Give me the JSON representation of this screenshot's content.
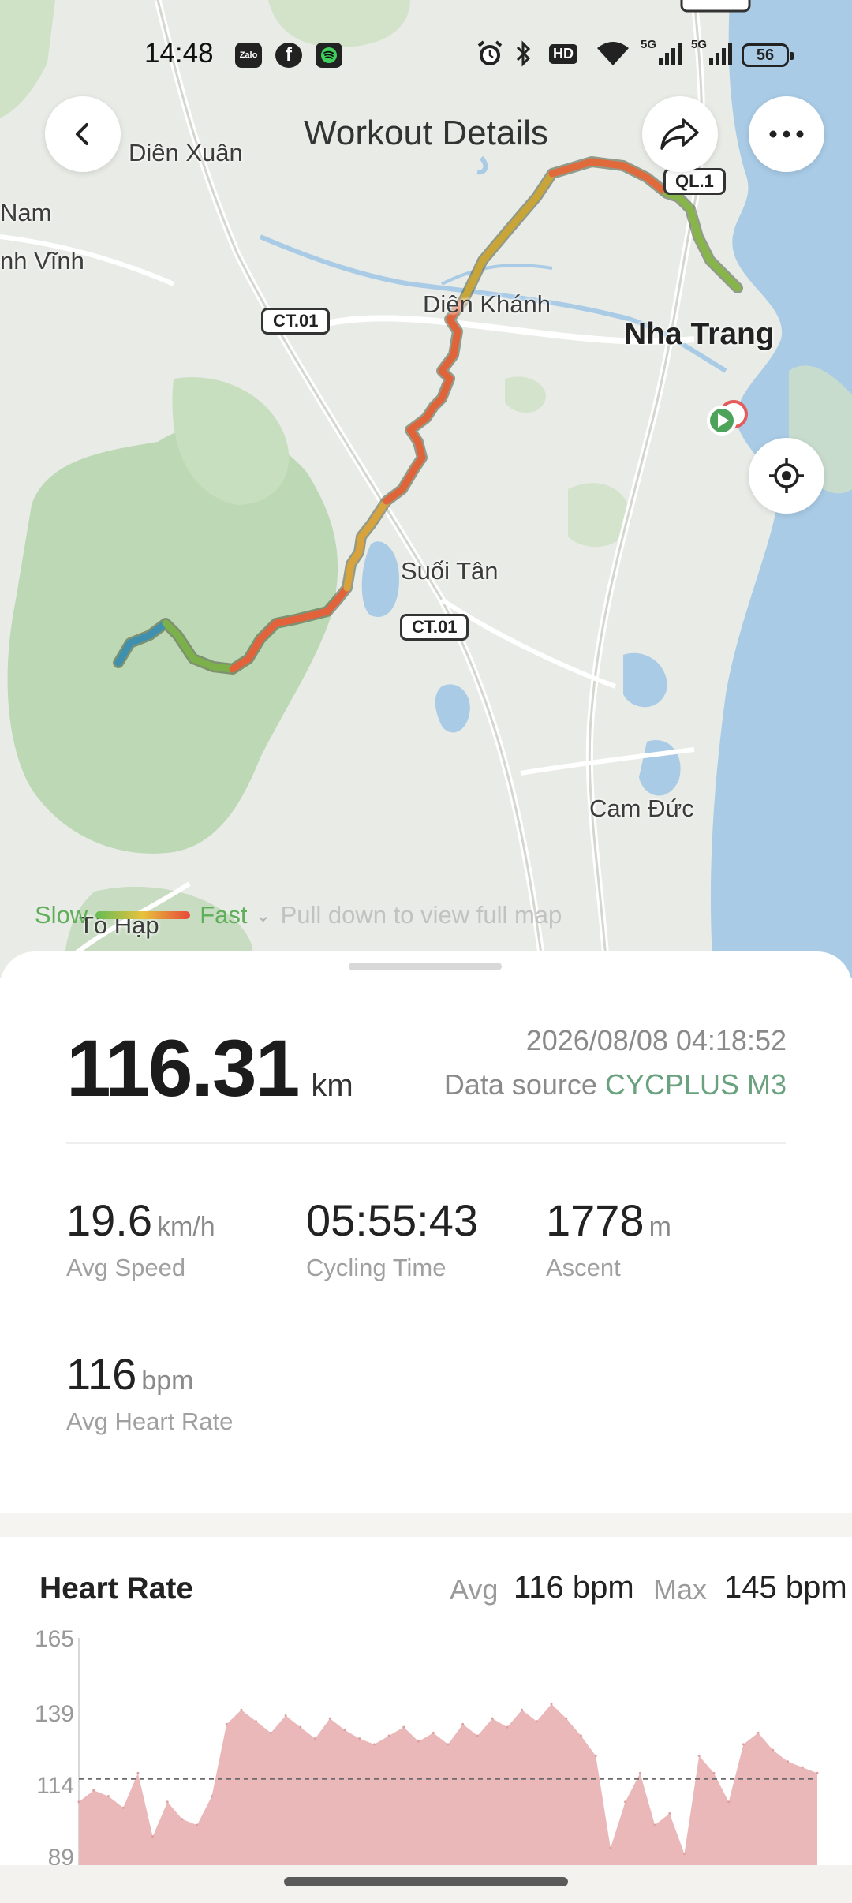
{
  "status_bar": {
    "time": "14:48",
    "apps": [
      "Zalo",
      "f",
      "spotify"
    ],
    "icons": [
      "alarm-icon",
      "bluetooth-icon",
      "hd-icon",
      "wifi-icon",
      "signal-5g-icon",
      "signal-5g-icon"
    ],
    "hd_label": "HD",
    "net_label_1": "5G",
    "net_label_2": "5G",
    "battery": "56"
  },
  "header": {
    "title": "Workout Details"
  },
  "map": {
    "places": {
      "dien_xuan": "Diên Xuân",
      "nam": "Nam",
      "vinh": "nh Vĩnh",
      "dien_khanh": "Diên Khánh",
      "nha_trang": "Nha Trang",
      "suoi_tan": "Suối Tân",
      "cam_duc": "Cam Đức",
      "to_hap": "Tô Hạp"
    },
    "road_shields": {
      "ql1": "QL.1",
      "ct01_a": "CT.01",
      "ct01_b": "CT.01"
    },
    "legend": {
      "slow": "Slow",
      "fast": "Fast",
      "hint": "Pull down to view full map"
    }
  },
  "summary": {
    "distance": "116.31",
    "distance_unit": "km",
    "datetime": "2026/08/08 04:18:52",
    "source_label": "Data source",
    "source_device": "CYCPLUS M3"
  },
  "stats": {
    "avg_speed": {
      "value": "19.6",
      "unit": "km/h",
      "label": "Avg Speed"
    },
    "cycling_time": {
      "value": "05:55:43",
      "label": "Cycling Time"
    },
    "ascent": {
      "value": "1778",
      "unit": "m",
      "label": "Ascent"
    },
    "avg_heart_rate": {
      "value": "116",
      "unit": "bpm",
      "label": "Avg Heart Rate"
    }
  },
  "heart_rate": {
    "title": "Heart Rate",
    "avg_label": "Avg",
    "avg_value": "116 bpm",
    "max_label": "Max",
    "max_value": "145 bpm"
  },
  "chart_data": {
    "type": "area",
    "title": "Heart Rate",
    "xlabel": "",
    "ylabel": "",
    "y_ticks": [
      "165",
      "139",
      "114",
      "89"
    ],
    "ylim": [
      80,
      165
    ],
    "reference_line": 116,
    "x": [
      0,
      0.02,
      0.04,
      0.06,
      0.08,
      0.1,
      0.12,
      0.14,
      0.16,
      0.18,
      0.2,
      0.22,
      0.24,
      0.26,
      0.28,
      0.3,
      0.32,
      0.34,
      0.36,
      0.38,
      0.4,
      0.42,
      0.44,
      0.46,
      0.48,
      0.5,
      0.52,
      0.54,
      0.56,
      0.58,
      0.6,
      0.62,
      0.64,
      0.66,
      0.68,
      0.7,
      0.72,
      0.74,
      0.76,
      0.78,
      0.8,
      0.82,
      0.84,
      0.86,
      0.88,
      0.9,
      0.92,
      0.94,
      0.96,
      0.98,
      1.0
    ],
    "values": [
      108,
      112,
      110,
      106,
      118,
      96,
      108,
      102,
      100,
      110,
      135,
      140,
      136,
      132,
      138,
      134,
      130,
      137,
      133,
      130,
      128,
      131,
      134,
      129,
      132,
      128,
      135,
      131,
      137,
      134,
      140,
      136,
      142,
      137,
      131,
      124,
      92,
      108,
      118,
      100,
      104,
      90,
      124,
      118,
      108,
      128,
      132,
      126,
      122,
      120,
      118
    ]
  }
}
